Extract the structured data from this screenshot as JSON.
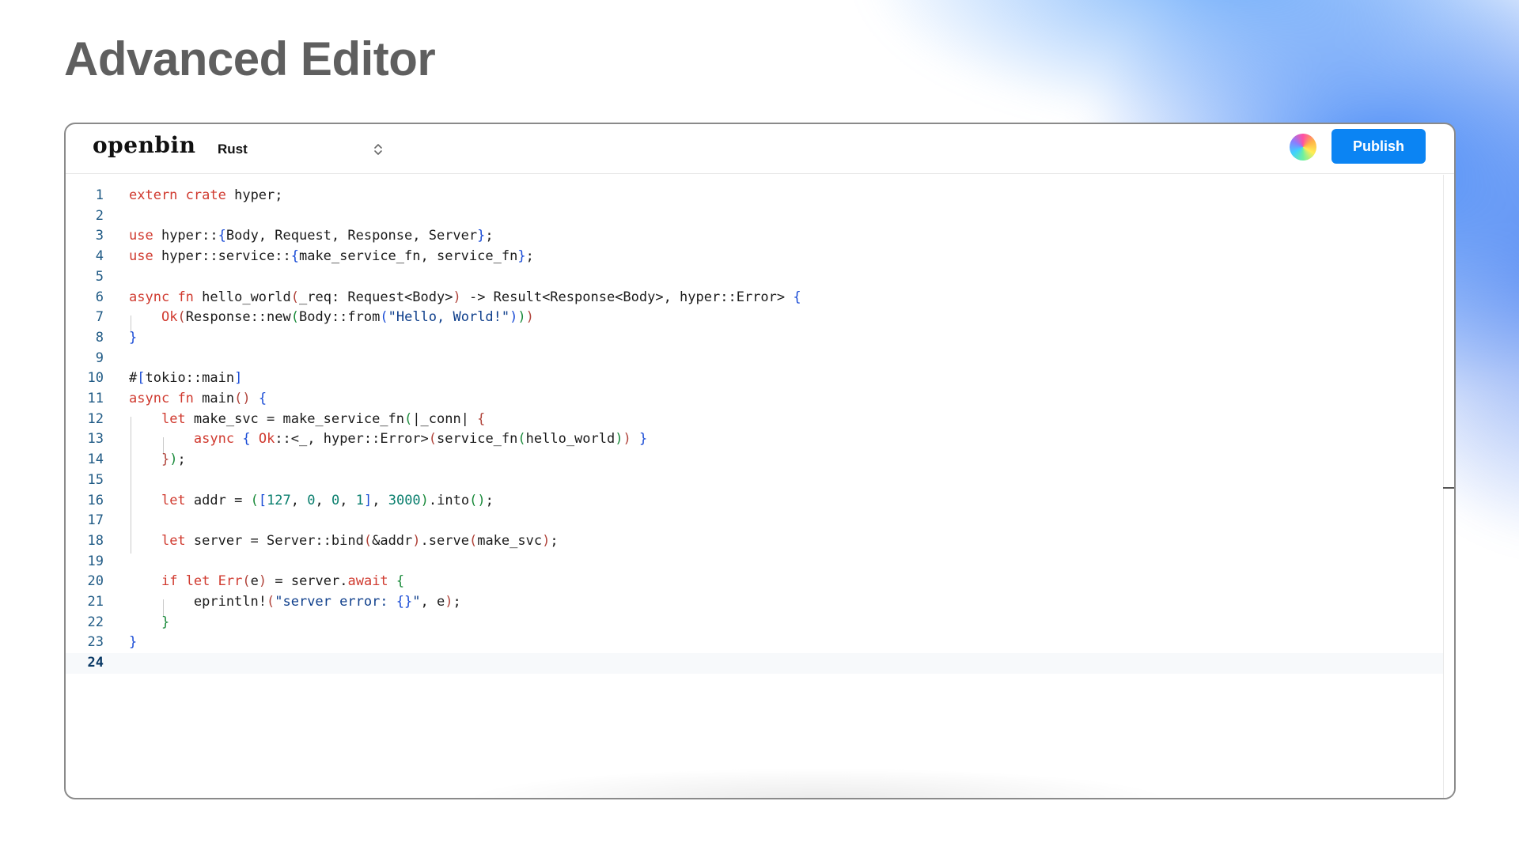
{
  "page": {
    "title": "Advanced Editor"
  },
  "toolbar": {
    "logo": "openbin",
    "language": "Rust",
    "publish_label": "Publish"
  },
  "editor": {
    "active_line": 24,
    "lines": [
      {
        "n": "1",
        "tokens": [
          [
            "kw",
            "extern"
          ],
          [
            "",
            ""
          ],
          [
            "",
            " "
          ],
          [
            "kw",
            "crate"
          ],
          [
            "",
            " hyper;"
          ]
        ]
      },
      {
        "n": "2",
        "tokens": []
      },
      {
        "n": "3",
        "tokens": [
          [
            "kw",
            "use"
          ],
          [
            "",
            " hyper::"
          ],
          [
            "pb",
            "{"
          ],
          [
            "",
            "Body, Request, Response, Server"
          ],
          [
            "pb",
            "}"
          ],
          [
            "",
            ";"
          ]
        ]
      },
      {
        "n": "4",
        "tokens": [
          [
            "kw",
            "use"
          ],
          [
            "",
            " hyper::service::"
          ],
          [
            "pb",
            "{"
          ],
          [
            "",
            "make_service_fn, service_fn"
          ],
          [
            "pb",
            "}"
          ],
          [
            "",
            ";"
          ]
        ]
      },
      {
        "n": "5",
        "tokens": []
      },
      {
        "n": "6",
        "tokens": [
          [
            "kw",
            "async"
          ],
          [
            "",
            " "
          ],
          [
            "kw",
            "fn"
          ],
          [
            "",
            " hello_world"
          ],
          [
            "pr",
            "("
          ],
          [
            "",
            "_req: Request<Body>"
          ],
          [
            "pr",
            ")"
          ],
          [
            "",
            " -> Result<Response<Body>, hyper::Error> "
          ],
          [
            "pb",
            "{"
          ]
        ]
      },
      {
        "n": "7",
        "tokens": [
          [
            "",
            "    "
          ],
          [
            "kw",
            "Ok"
          ],
          [
            "pr",
            "("
          ],
          [
            "",
            "Response::new"
          ],
          [
            "pg",
            "("
          ],
          [
            "",
            "Body::from"
          ],
          [
            "pb",
            "("
          ],
          [
            "str",
            "\"Hello, World!\""
          ],
          [
            "pb",
            ")"
          ],
          [
            "pg",
            ")"
          ],
          [
            "pr",
            ")"
          ]
        ]
      },
      {
        "n": "8",
        "tokens": [
          [
            "pb",
            "}"
          ]
        ]
      },
      {
        "n": "9",
        "tokens": []
      },
      {
        "n": "10",
        "tokens": [
          [
            "",
            "#"
          ],
          [
            "pb",
            "["
          ],
          [
            "",
            "tokio::main"
          ],
          [
            "pb",
            "]"
          ]
        ]
      },
      {
        "n": "11",
        "tokens": [
          [
            "kw",
            "async"
          ],
          [
            "",
            " "
          ],
          [
            "kw",
            "fn"
          ],
          [
            "",
            " main"
          ],
          [
            "pr",
            "()"
          ],
          [
            "",
            " "
          ],
          [
            "pb",
            "{"
          ]
        ]
      },
      {
        "n": "12",
        "tokens": [
          [
            "",
            "    "
          ],
          [
            "kw",
            "let"
          ],
          [
            "",
            " make_svc = make_service_fn"
          ],
          [
            "pg",
            "("
          ],
          [
            "",
            "|_conn| "
          ],
          [
            "pr",
            "{"
          ]
        ]
      },
      {
        "n": "13",
        "tokens": [
          [
            "",
            "        "
          ],
          [
            "kw",
            "async"
          ],
          [
            "",
            " "
          ],
          [
            "pb",
            "{"
          ],
          [
            "",
            " "
          ],
          [
            "kw",
            "Ok"
          ],
          [
            "",
            "::<_, hyper::Error>"
          ],
          [
            "pr",
            "("
          ],
          [
            "",
            "service_fn"
          ],
          [
            "pg",
            "("
          ],
          [
            "",
            "hello_world"
          ],
          [
            "pg",
            ")"
          ],
          [
            "pr",
            ")"
          ],
          [
            "",
            " "
          ],
          [
            "pb",
            "}"
          ]
        ]
      },
      {
        "n": "14",
        "tokens": [
          [
            "",
            "    "
          ],
          [
            "pr",
            "}"
          ],
          [
            "pg",
            ")"
          ],
          [
            "",
            ";"
          ]
        ]
      },
      {
        "n": "15",
        "tokens": []
      },
      {
        "n": "16",
        "tokens": [
          [
            "",
            "    "
          ],
          [
            "kw",
            "let"
          ],
          [
            "",
            " addr = "
          ],
          [
            "pg",
            "("
          ],
          [
            "pb",
            "["
          ],
          [
            "num",
            "127"
          ],
          [
            "",
            ", "
          ],
          [
            "num",
            "0"
          ],
          [
            "",
            ", "
          ],
          [
            "num",
            "0"
          ],
          [
            "",
            ", "
          ],
          [
            "num",
            "1"
          ],
          [
            "pb",
            "]"
          ],
          [
            "",
            ", "
          ],
          [
            "num",
            "3000"
          ],
          [
            "pg",
            ")"
          ],
          [
            "",
            ".into"
          ],
          [
            "pg",
            "()"
          ],
          [
            "",
            ";"
          ]
        ]
      },
      {
        "n": "17",
        "tokens": []
      },
      {
        "n": "18",
        "tokens": [
          [
            "",
            "    "
          ],
          [
            "kw",
            "let"
          ],
          [
            "",
            " server = Server::bind"
          ],
          [
            "pr",
            "("
          ],
          [
            "",
            "&addr"
          ],
          [
            "pr",
            ")"
          ],
          [
            "",
            ".serve"
          ],
          [
            "pr",
            "("
          ],
          [
            "",
            "make_svc"
          ],
          [
            "pr",
            ")"
          ],
          [
            "",
            ";"
          ]
        ]
      },
      {
        "n": "19",
        "tokens": []
      },
      {
        "n": "20",
        "tokens": [
          [
            "",
            "    "
          ],
          [
            "kw",
            "if"
          ],
          [
            "",
            " "
          ],
          [
            "kw",
            "let"
          ],
          [
            "",
            " "
          ],
          [
            "kw",
            "Err"
          ],
          [
            "pr",
            "("
          ],
          [
            "",
            "e"
          ],
          [
            "pr",
            ")"
          ],
          [
            "",
            " = server."
          ],
          [
            "kw",
            "await"
          ],
          [
            "",
            " "
          ],
          [
            "pg",
            "{"
          ]
        ]
      },
      {
        "n": "21",
        "tokens": [
          [
            "",
            "        eprintln!"
          ],
          [
            "pr",
            "("
          ],
          [
            "str",
            "\"server error: "
          ],
          [
            "pb",
            "{}"
          ],
          [
            "str",
            "\""
          ],
          [
            "",
            ", e"
          ],
          [
            "pr",
            ")"
          ],
          [
            "",
            ";"
          ]
        ]
      },
      {
        "n": "22",
        "tokens": [
          [
            "",
            "    "
          ],
          [
            "pg",
            "}"
          ]
        ]
      },
      {
        "n": "23",
        "tokens": [
          [
            "pb",
            "}"
          ]
        ]
      },
      {
        "n": "24",
        "tokens": []
      }
    ]
  }
}
